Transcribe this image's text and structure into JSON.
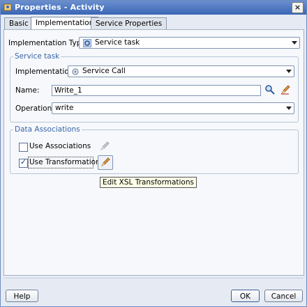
{
  "window": {
    "title": "Properties - Activity",
    "close_label": "×"
  },
  "tabs": [
    {
      "label": "Basic"
    },
    {
      "label": "Implementation"
    },
    {
      "label": "Service Properties"
    }
  ],
  "implementation_type": {
    "label": "Implementation Type:",
    "value": "Service task"
  },
  "service_task": {
    "legend": "Service task",
    "implementation": {
      "label": "Implementation:",
      "value": "Service Call"
    },
    "name": {
      "label": "Name:",
      "value": "Write_1"
    },
    "operation": {
      "label": "Operation:",
      "value": "write"
    }
  },
  "data_associations": {
    "legend": "Data Associations",
    "use_associations": {
      "label": "Use Associations",
      "checked": false
    },
    "use_transformations": {
      "label": "Use Transformations",
      "checked": true
    },
    "tooltip": "Edit XSL Transformations"
  },
  "buttons": {
    "help": "Help",
    "ok": "OK",
    "cancel": "Cancel"
  },
  "icons": {
    "title": "properties-icon",
    "implementation_type": "gear-icon",
    "implementation": "gear-icon",
    "search": "search-icon",
    "edit": "pencil-icon"
  }
}
